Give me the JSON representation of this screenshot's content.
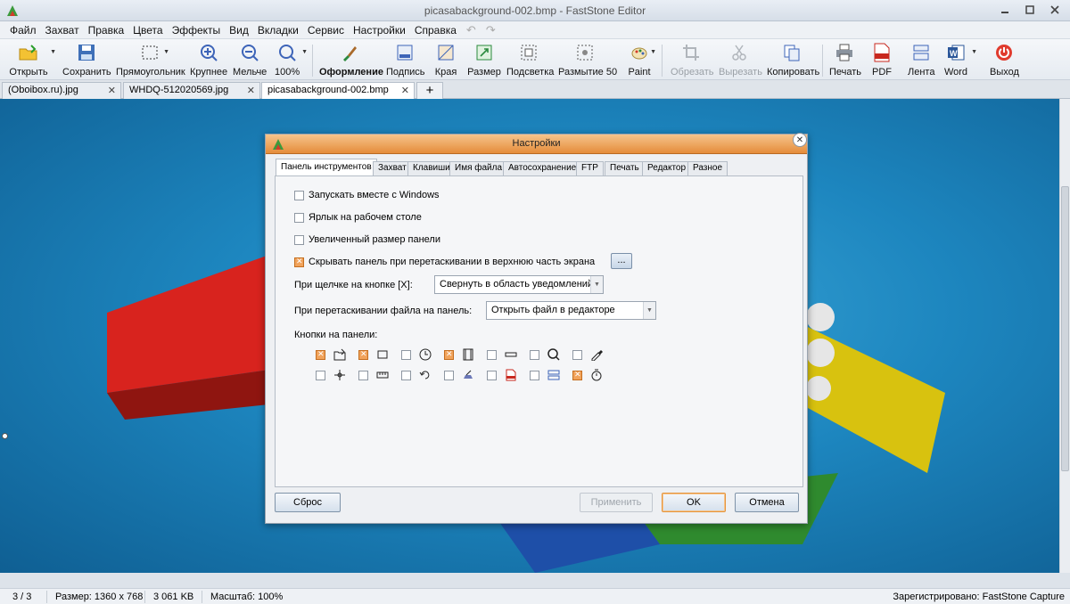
{
  "window": {
    "title": "picasabackground-002.bmp - FastStone Editor"
  },
  "menu": [
    "Файл",
    "Захват",
    "Правка",
    "Цвета",
    "Эффекты",
    "Вид",
    "Вкладки",
    "Сервис",
    "Настройки",
    "Справка"
  ],
  "toolbar": {
    "open": "Открыть",
    "save": "Сохранить",
    "rect": "Прямоугольник",
    "zoom_in": "Крупнее",
    "zoom_out": "Мельче",
    "zoom_100": "100%",
    "design": "Оформление",
    "caption": "Подпись",
    "edges": "Края",
    "resize": "Размер",
    "spotlight": "Подсветка",
    "blur": "Размытие 50",
    "paint": "Paint",
    "crop": "Обрезать",
    "cut": "Вырезать",
    "copy": "Копировать",
    "print": "Печать",
    "pdf": "PDF",
    "ribbon": "Лента",
    "word": "Word",
    "exit": "Выход"
  },
  "tabs": [
    "(Oboibox.ru).jpg",
    "WHDQ-512020569.jpg",
    "picasabackground-002.bmp"
  ],
  "dialog": {
    "title": "Настройки",
    "tabs": [
      "Панель инструментов",
      "Захват",
      "Клавиши",
      "Имя файла",
      "Автосохранение",
      "FTP",
      "Печать",
      "Редактор",
      "Разное"
    ],
    "options": [
      {
        "label": "Запускать вместе с Windows",
        "checked": false
      },
      {
        "label": "Ярлык на рабочем столе",
        "checked": false
      },
      {
        "label": "Увеличенный размер панели",
        "checked": false
      },
      {
        "label": "Скрывать панель при перетаскивании в верхнюю часть экрана",
        "checked": true
      }
    ],
    "dots": "...",
    "click_label": "При щелчке на кнопке [X]:",
    "click_value": "Свернуть в область уведомлений",
    "drop_label": "При перетаскивании файла на панель:",
    "drop_value": "Открыть файл в редакторе",
    "buttons_label": "Кнопки на панели:",
    "reset": "Сброс",
    "apply": "Применить",
    "ok": "OK",
    "cancel": "Отмена"
  },
  "status": {
    "index": "3 / 3",
    "size": "Размер: 1360 x 768",
    "filesize": "3 061 KB",
    "zoom": "Масштаб: 100%",
    "registered": "Зарегистрировано: FastStone Capture"
  }
}
